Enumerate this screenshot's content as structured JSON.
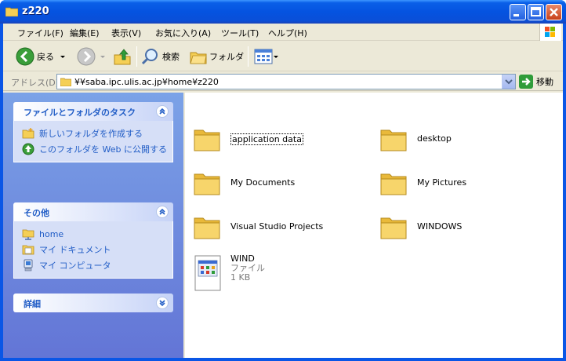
{
  "window": {
    "title": "z220"
  },
  "menu": [
    "ファイル(F)",
    "編集(E)",
    "表示(V)",
    "お気に入り(A)",
    "ツール(T)",
    "ヘルプ(H)"
  ],
  "toolbar": {
    "back_label": "戻る",
    "search_label": "検索",
    "folders_label": "フォルダ"
  },
  "address": {
    "label": "アドレス(D)",
    "value": "¥¥saba.ipc.ulis.ac.jp¥home¥z220",
    "go_label": "移動"
  },
  "taskpane": {
    "file_tasks": {
      "title": "ファイルとフォルダのタスク",
      "items": [
        "新しいフォルダを作成する",
        "このフォルダを Web に公開する"
      ]
    },
    "other_places": {
      "title": "その他",
      "items": [
        "home",
        "マイ ドキュメント",
        "マイ コンピュータ"
      ]
    },
    "details": {
      "title": "詳細"
    }
  },
  "content": {
    "folders": [
      "application data",
      "desktop",
      "My Documents",
      "My Pictures",
      "Visual Studio Projects",
      "WINDOWS"
    ],
    "file": {
      "name": "WIND",
      "type": "ファイル",
      "size": "1 KB"
    }
  },
  "colors": {
    "title_blue": "#0553e0",
    "task_link": "#215dc6",
    "folder_yellow": "#f7d56b"
  }
}
